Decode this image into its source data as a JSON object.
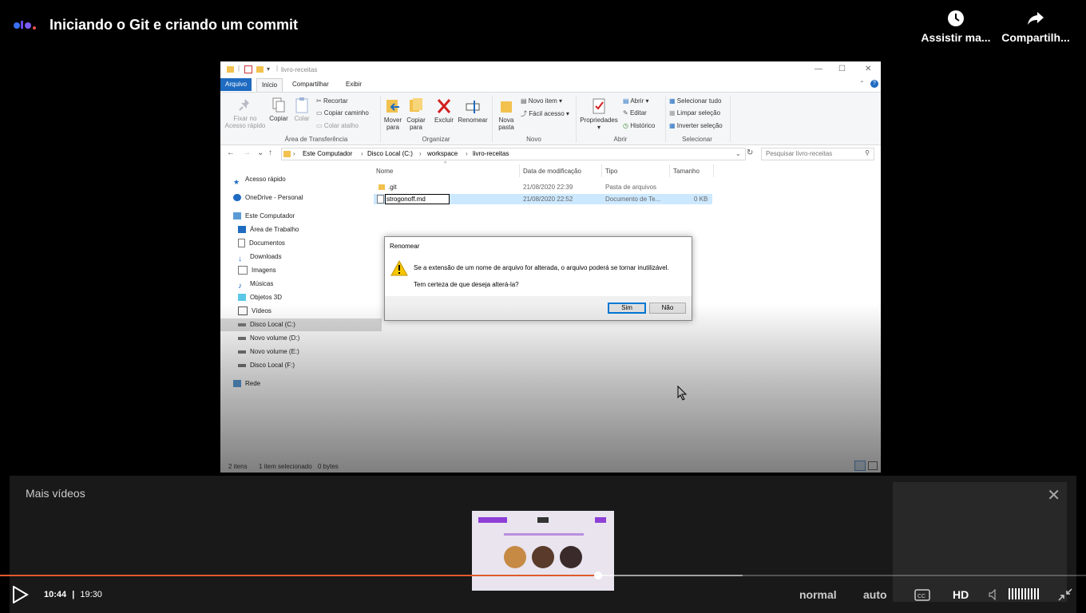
{
  "player": {
    "title": "Iniciando o Git e criando um commit",
    "watch_later": "Assistir ma...",
    "share": "Compartilh...",
    "more_videos": "Mais vídeos",
    "time_current": "10:44",
    "time_separator": "|",
    "time_total": "19:30",
    "progress": 0.551,
    "speed": "normal",
    "quality_auto": "auto",
    "quality_hd": "HD",
    "accent_color": "#e05a2b",
    "icons": [
      "clock-icon",
      "share-icon",
      "close-icon",
      "play-icon",
      "cc-icon",
      "volume-icon",
      "exit-fullscreen-icon"
    ]
  },
  "explorer": {
    "window_title": "livro-receitas",
    "tabs": [
      "Arquivo",
      "Início",
      "Compartilhar",
      "Exibir"
    ],
    "ribbon": {
      "clipboard": {
        "pin": "Fixar no\nAcesso rápido",
        "copy": "Copiar",
        "paste": "Colar",
        "cut": "Recortar",
        "copy_path": "Copiar caminho",
        "paste_shortcut": "Colar atalho",
        "group": "Área de Transferência"
      },
      "organize": {
        "move": "Mover\npara",
        "copy_to": "Copiar\npara",
        "delete": "Excluir",
        "rename": "Renomear",
        "group": "Organizar"
      },
      "new": {
        "new_folder": "Nova\npasta",
        "new_item": "Novo item",
        "easy_access": "Fácil acesso",
        "group": "Novo"
      },
      "open": {
        "properties": "Propriedades",
        "open": "Abrir",
        "edit": "Editar",
        "history": "Histórico",
        "group": "Abrir"
      },
      "select": {
        "select_all": "Selecionar tudo",
        "select_none": "Limpar seleção",
        "invert": "Inverter seleção",
        "group": "Selecionar"
      }
    },
    "breadcrumb": [
      "Este Computador",
      "Disco Local (C:)",
      "workspace",
      "livro-receitas"
    ],
    "search_placeholder": "Pesquisar livro-receitas",
    "nav": {
      "quick_access": "Acesso rápido",
      "onedrive": "OneDrive - Personal",
      "this_pc": "Este Computador",
      "desktop": "Área de Trabalho",
      "documents": "Documentos",
      "downloads": "Downloads",
      "pictures": "Imagens",
      "music": "Músicas",
      "objects3d": "Objetos 3D",
      "videos": "Vídeos",
      "disk_c": "Disco Local (C:)",
      "vol_d": "Novo volume (D:)",
      "vol_e": "Novo volume (E:)",
      "disk_f": "Disco Local (F:)",
      "network": "Rede"
    },
    "columns": [
      "Nome",
      "Data de modificação",
      "Tipo",
      "Tamanho"
    ],
    "files": [
      {
        "name": ".git",
        "date": "21/08/2020 22:39",
        "type": "Pasta de arquivos",
        "size": ""
      },
      {
        "name": "strogonoff.md",
        "date": "21/08/2020 22:52",
        "type": "Documento de Te...",
        "size": "0 KB"
      }
    ],
    "status": {
      "count": "2 itens",
      "selected": "1 item selecionado",
      "size": "0 bytes"
    },
    "dialog": {
      "title": "Renomear",
      "message": "Se a extensão de um nome de arquivo for alterada, o arquivo poderá se tornar inutilizável.",
      "question": "Tem certeza de que deseja alterá-la?",
      "yes": "Sim",
      "no": "Não"
    }
  }
}
